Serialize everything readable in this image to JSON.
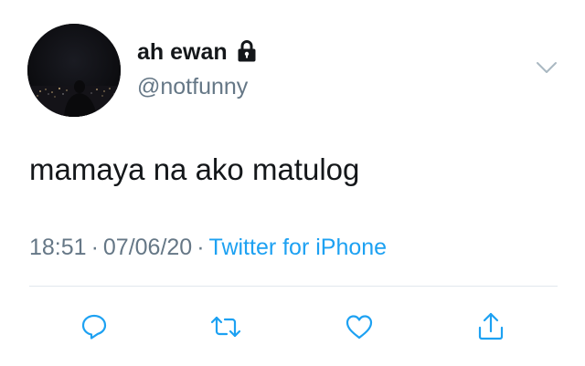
{
  "author": {
    "display_name": "ah ewan",
    "handle": "@notfunny",
    "protected_icon": "lock-icon",
    "avatar_icon": "night-city-photo"
  },
  "tweet": {
    "text": "mamaya na ako matulog",
    "time": "18:51",
    "date": "07/06/20",
    "separator": "·",
    "source": "Twitter for iPhone"
  },
  "actions": {
    "reply_icon": "reply-icon",
    "retweet_icon": "retweet-icon",
    "like_icon": "heart-icon",
    "share_icon": "share-icon",
    "menu_icon": "chevron-down-icon"
  },
  "colors": {
    "text": "#14171a",
    "secondary": "#657786",
    "link": "#1da1f2",
    "divider": "#e1e8ed",
    "icon": "#1da1f2",
    "chevron": "#aab8c2"
  }
}
